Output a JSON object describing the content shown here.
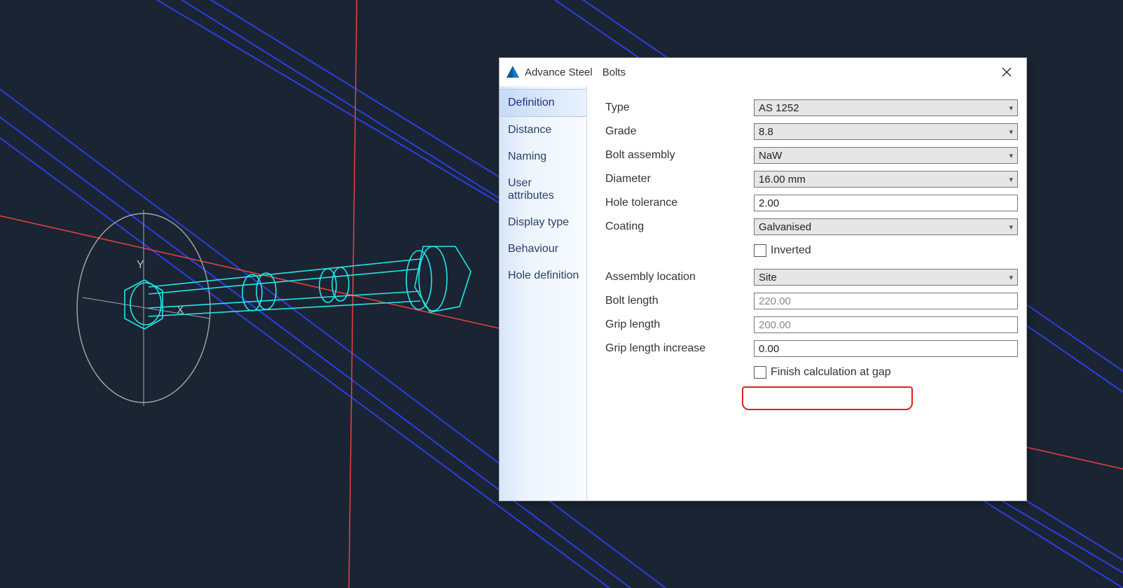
{
  "dialog": {
    "title": "Advance Steel",
    "subtitle": "Bolts",
    "tabs": [
      {
        "label": "Definition",
        "active": true
      },
      {
        "label": "Distance"
      },
      {
        "label": "Naming"
      },
      {
        "label": "User attributes"
      },
      {
        "label": "Display type"
      },
      {
        "label": "Behaviour"
      },
      {
        "label": "Hole definition"
      }
    ],
    "fields": {
      "type": {
        "label": "Type",
        "value": "AS 1252",
        "kind": "select"
      },
      "grade": {
        "label": "Grade",
        "value": "8.8",
        "kind": "select"
      },
      "bolt_assembly": {
        "label": "Bolt assembly",
        "value": "NaW",
        "kind": "select"
      },
      "diameter": {
        "label": "Diameter",
        "value": "16.00 mm",
        "kind": "select"
      },
      "hole_tolerance": {
        "label": "Hole tolerance",
        "value": "2.00",
        "kind": "input"
      },
      "coating": {
        "label": "Coating",
        "value": "Galvanised",
        "kind": "select"
      },
      "inverted": {
        "label": "Inverted",
        "checked": false,
        "kind": "check"
      },
      "assembly_location": {
        "label": "Assembly location",
        "value": "Site",
        "kind": "select"
      },
      "bolt_length": {
        "label": "Bolt length",
        "value": "220.00",
        "kind": "readonly"
      },
      "grip_length": {
        "label": "Grip length",
        "value": "200.00",
        "kind": "readonly"
      },
      "grip_length_increase": {
        "label": "Grip length increase",
        "value": "0.00",
        "kind": "input"
      },
      "finish_calc_gap": {
        "label": "Finish calculation at gap",
        "checked": false,
        "kind": "check"
      }
    }
  },
  "axes": {
    "x": "X",
    "y": "Y"
  }
}
